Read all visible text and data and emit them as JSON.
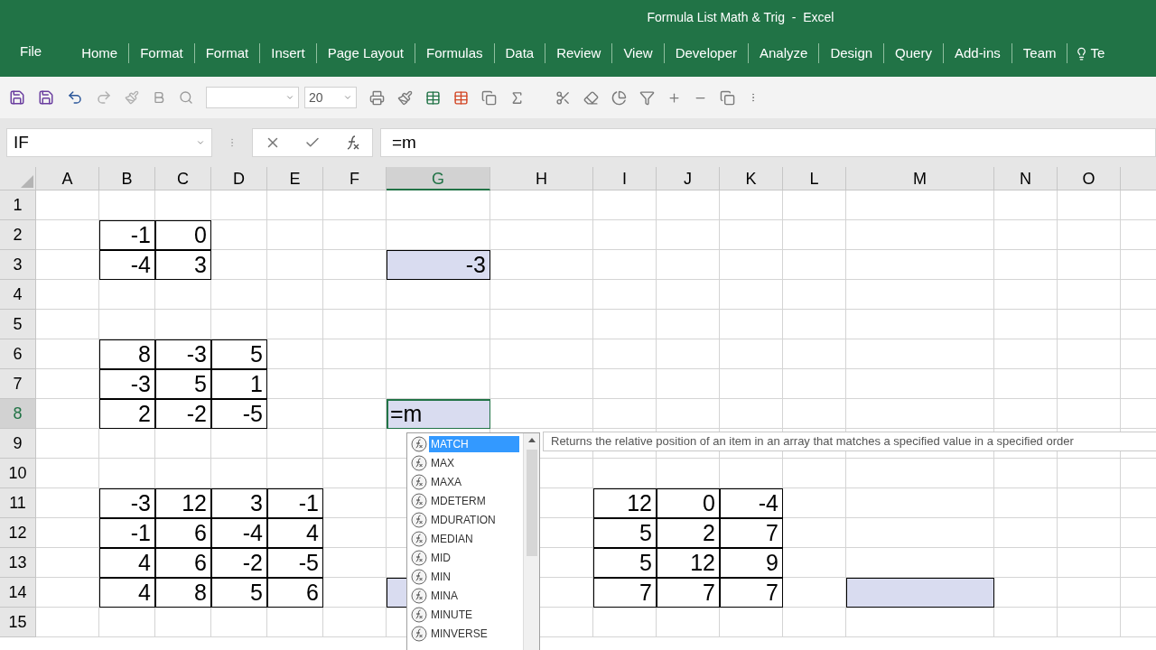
{
  "window": {
    "title": "Formula List Math & Trig  -  Excel"
  },
  "ribbon_tabs": [
    {
      "label": "File",
      "selected": false
    },
    {
      "label": "Home",
      "selected": false
    },
    {
      "label": "Format",
      "selected": false
    },
    {
      "label": "Format",
      "selected": false
    },
    {
      "label": "Insert",
      "selected": false
    },
    {
      "label": "Page Layout",
      "selected": false
    },
    {
      "label": "Formulas",
      "selected": false
    },
    {
      "label": "Data",
      "selected": false
    },
    {
      "label": "Review",
      "selected": false
    },
    {
      "label": "View",
      "selected": false
    },
    {
      "label": "Developer",
      "selected": false
    },
    {
      "label": "Analyze",
      "selected": false
    },
    {
      "label": "Design",
      "selected": false
    },
    {
      "label": "Query",
      "selected": false
    },
    {
      "label": "Add-ins",
      "selected": false
    },
    {
      "label": "Team",
      "selected": false
    }
  ],
  "tell_me": "Te",
  "toolbar": {
    "font_size": "20"
  },
  "formula_bar": {
    "name_box": "IF",
    "formula": "=m"
  },
  "columns": [
    {
      "letter": "A",
      "selected": false
    },
    {
      "letter": "B",
      "selected": false
    },
    {
      "letter": "C",
      "selected": false
    },
    {
      "letter": "D",
      "selected": false
    },
    {
      "letter": "E",
      "selected": false
    },
    {
      "letter": "F",
      "selected": false
    },
    {
      "letter": "G",
      "selected": true
    },
    {
      "letter": "H",
      "selected": false
    },
    {
      "letter": "I",
      "selected": false
    },
    {
      "letter": "J",
      "selected": false
    },
    {
      "letter": "K",
      "selected": false
    },
    {
      "letter": "L",
      "selected": false
    },
    {
      "letter": "M",
      "selected": false
    },
    {
      "letter": "N",
      "selected": false
    },
    {
      "letter": "O",
      "selected": false
    }
  ],
  "rows": [
    {
      "number": "1",
      "selected": false,
      "cells": [
        {
          "kind": "plain"
        },
        {
          "kind": "plain"
        },
        {
          "kind": "plain"
        },
        {
          "kind": "plain"
        },
        {
          "kind": "plain"
        },
        {
          "kind": "plain"
        },
        {
          "kind": "plain"
        },
        {
          "kind": "plain"
        },
        {
          "kind": "plain"
        },
        {
          "kind": "plain"
        },
        {
          "kind": "plain"
        },
        {
          "kind": "plain"
        },
        {
          "kind": "plain"
        },
        {
          "kind": "plain"
        },
        {
          "kind": "plain"
        }
      ]
    },
    {
      "number": "2",
      "selected": false,
      "cells": [
        {
          "kind": "plain"
        },
        {
          "kind": "boxed",
          "value": "-1"
        },
        {
          "kind": "boxed",
          "value": "0"
        },
        {
          "kind": "plain"
        },
        {
          "kind": "plain"
        },
        {
          "kind": "plain"
        },
        {
          "kind": "plain"
        },
        {
          "kind": "plain"
        },
        {
          "kind": "plain"
        },
        {
          "kind": "plain"
        },
        {
          "kind": "plain"
        },
        {
          "kind": "plain"
        },
        {
          "kind": "plain"
        },
        {
          "kind": "plain"
        },
        {
          "kind": "plain"
        }
      ]
    },
    {
      "number": "3",
      "selected": false,
      "cells": [
        {
          "kind": "plain"
        },
        {
          "kind": "boxed",
          "value": "-4"
        },
        {
          "kind": "boxed",
          "value": "3"
        },
        {
          "kind": "plain"
        },
        {
          "kind": "plain"
        },
        {
          "kind": "plain"
        },
        {
          "kind": "boxed-shaded",
          "value": "-3"
        },
        {
          "kind": "plain"
        },
        {
          "kind": "plain"
        },
        {
          "kind": "plain"
        },
        {
          "kind": "plain"
        },
        {
          "kind": "plain"
        },
        {
          "kind": "plain"
        },
        {
          "kind": "plain"
        },
        {
          "kind": "plain"
        }
      ]
    },
    {
      "number": "4",
      "selected": false,
      "cells": [
        {
          "kind": "plain"
        },
        {
          "kind": "plain"
        },
        {
          "kind": "plain"
        },
        {
          "kind": "plain"
        },
        {
          "kind": "plain"
        },
        {
          "kind": "plain"
        },
        {
          "kind": "plain"
        },
        {
          "kind": "plain"
        },
        {
          "kind": "plain"
        },
        {
          "kind": "plain"
        },
        {
          "kind": "plain"
        },
        {
          "kind": "plain"
        },
        {
          "kind": "plain"
        },
        {
          "kind": "plain"
        },
        {
          "kind": "plain"
        }
      ]
    },
    {
      "number": "5",
      "selected": false,
      "cells": [
        {
          "kind": "plain"
        },
        {
          "kind": "plain"
        },
        {
          "kind": "plain"
        },
        {
          "kind": "plain"
        },
        {
          "kind": "plain"
        },
        {
          "kind": "plain"
        },
        {
          "kind": "plain"
        },
        {
          "kind": "plain"
        },
        {
          "kind": "plain"
        },
        {
          "kind": "plain"
        },
        {
          "kind": "plain"
        },
        {
          "kind": "plain"
        },
        {
          "kind": "plain"
        },
        {
          "kind": "plain"
        },
        {
          "kind": "plain"
        }
      ]
    },
    {
      "number": "6",
      "selected": false,
      "cells": [
        {
          "kind": "plain"
        },
        {
          "kind": "boxed",
          "value": "8"
        },
        {
          "kind": "boxed",
          "value": "-3"
        },
        {
          "kind": "boxed",
          "value": "5"
        },
        {
          "kind": "plain"
        },
        {
          "kind": "plain"
        },
        {
          "kind": "plain"
        },
        {
          "kind": "plain"
        },
        {
          "kind": "plain"
        },
        {
          "kind": "plain"
        },
        {
          "kind": "plain"
        },
        {
          "kind": "plain"
        },
        {
          "kind": "plain"
        },
        {
          "kind": "plain"
        },
        {
          "kind": "plain"
        }
      ]
    },
    {
      "number": "7",
      "selected": false,
      "cells": [
        {
          "kind": "plain"
        },
        {
          "kind": "boxed",
          "value": "-3"
        },
        {
          "kind": "boxed",
          "value": "5"
        },
        {
          "kind": "boxed",
          "value": "1"
        },
        {
          "kind": "plain"
        },
        {
          "kind": "plain"
        },
        {
          "kind": "plain"
        },
        {
          "kind": "plain"
        },
        {
          "kind": "plain"
        },
        {
          "kind": "plain"
        },
        {
          "kind": "plain"
        },
        {
          "kind": "plain"
        },
        {
          "kind": "plain"
        },
        {
          "kind": "plain"
        },
        {
          "kind": "plain"
        }
      ]
    },
    {
      "number": "8",
      "selected": true,
      "cells": [
        {
          "kind": "plain"
        },
        {
          "kind": "boxed",
          "value": "2"
        },
        {
          "kind": "boxed",
          "value": "-2"
        },
        {
          "kind": "boxed",
          "value": "-5"
        },
        {
          "kind": "plain"
        },
        {
          "kind": "plain"
        },
        {
          "kind": "editing",
          "value": "=m"
        },
        {
          "kind": "plain"
        },
        {
          "kind": "plain"
        },
        {
          "kind": "plain"
        },
        {
          "kind": "plain"
        },
        {
          "kind": "plain"
        },
        {
          "kind": "plain"
        },
        {
          "kind": "plain"
        },
        {
          "kind": "plain"
        }
      ]
    },
    {
      "number": "9",
      "selected": false,
      "cells": [
        {
          "kind": "plain"
        },
        {
          "kind": "plain"
        },
        {
          "kind": "plain"
        },
        {
          "kind": "plain"
        },
        {
          "kind": "plain"
        },
        {
          "kind": "plain"
        },
        {
          "kind": "plain"
        },
        {
          "kind": "plain"
        },
        {
          "kind": "plain"
        },
        {
          "kind": "plain"
        },
        {
          "kind": "plain"
        },
        {
          "kind": "plain"
        },
        {
          "kind": "plain"
        },
        {
          "kind": "plain"
        },
        {
          "kind": "plain"
        }
      ]
    },
    {
      "number": "10",
      "selected": false,
      "cells": [
        {
          "kind": "plain"
        },
        {
          "kind": "plain"
        },
        {
          "kind": "plain"
        },
        {
          "kind": "plain"
        },
        {
          "kind": "plain"
        },
        {
          "kind": "plain"
        },
        {
          "kind": "plain"
        },
        {
          "kind": "plain"
        },
        {
          "kind": "plain"
        },
        {
          "kind": "plain"
        },
        {
          "kind": "plain"
        },
        {
          "kind": "plain"
        },
        {
          "kind": "plain"
        },
        {
          "kind": "plain"
        },
        {
          "kind": "plain"
        }
      ]
    },
    {
      "number": "11",
      "selected": false,
      "cells": [
        {
          "kind": "plain"
        },
        {
          "kind": "boxed",
          "value": "-3"
        },
        {
          "kind": "boxed",
          "value": "12"
        },
        {
          "kind": "boxed",
          "value": "3"
        },
        {
          "kind": "boxed",
          "value": "-1"
        },
        {
          "kind": "plain"
        },
        {
          "kind": "plain"
        },
        {
          "kind": "plain"
        },
        {
          "kind": "boxed",
          "value": "12"
        },
        {
          "kind": "boxed",
          "value": "0"
        },
        {
          "kind": "boxed",
          "value": "-4"
        },
        {
          "kind": "plain"
        },
        {
          "kind": "plain"
        },
        {
          "kind": "plain"
        },
        {
          "kind": "plain"
        }
      ]
    },
    {
      "number": "12",
      "selected": false,
      "cells": [
        {
          "kind": "plain"
        },
        {
          "kind": "boxed",
          "value": "-1"
        },
        {
          "kind": "boxed",
          "value": "6"
        },
        {
          "kind": "boxed",
          "value": "-4"
        },
        {
          "kind": "boxed",
          "value": "4"
        },
        {
          "kind": "plain"
        },
        {
          "kind": "plain"
        },
        {
          "kind": "plain"
        },
        {
          "kind": "boxed",
          "value": "5"
        },
        {
          "kind": "boxed",
          "value": "2"
        },
        {
          "kind": "boxed",
          "value": "7"
        },
        {
          "kind": "plain"
        },
        {
          "kind": "plain"
        },
        {
          "kind": "plain"
        },
        {
          "kind": "plain"
        }
      ]
    },
    {
      "number": "13",
      "selected": false,
      "cells": [
        {
          "kind": "plain"
        },
        {
          "kind": "boxed",
          "value": "4"
        },
        {
          "kind": "boxed",
          "value": "6"
        },
        {
          "kind": "boxed",
          "value": "-2"
        },
        {
          "kind": "boxed",
          "value": "-5"
        },
        {
          "kind": "plain"
        },
        {
          "kind": "plain"
        },
        {
          "kind": "plain"
        },
        {
          "kind": "boxed",
          "value": "5"
        },
        {
          "kind": "boxed",
          "value": "12"
        },
        {
          "kind": "boxed",
          "value": "9"
        },
        {
          "kind": "plain"
        },
        {
          "kind": "plain"
        },
        {
          "kind": "plain"
        },
        {
          "kind": "plain"
        }
      ]
    },
    {
      "number": "14",
      "selected": false,
      "cells": [
        {
          "kind": "plain"
        },
        {
          "kind": "boxed",
          "value": "4"
        },
        {
          "kind": "boxed",
          "value": "8"
        },
        {
          "kind": "boxed",
          "value": "5"
        },
        {
          "kind": "boxed",
          "value": "6"
        },
        {
          "kind": "plain"
        },
        {
          "kind": "boxed-shaded"
        },
        {
          "kind": "plain"
        },
        {
          "kind": "boxed",
          "value": "7"
        },
        {
          "kind": "boxed",
          "value": "7"
        },
        {
          "kind": "boxed",
          "value": "7"
        },
        {
          "kind": "plain"
        },
        {
          "kind": "boxed-shaded"
        },
        {
          "kind": "plain"
        },
        {
          "kind": "plain"
        }
      ]
    },
    {
      "number": "15",
      "selected": false,
      "cells": [
        {
          "kind": "plain"
        },
        {
          "kind": "plain"
        },
        {
          "kind": "plain"
        },
        {
          "kind": "plain"
        },
        {
          "kind": "plain"
        },
        {
          "kind": "plain"
        },
        {
          "kind": "plain"
        },
        {
          "kind": "plain"
        },
        {
          "kind": "plain"
        },
        {
          "kind": "plain"
        },
        {
          "kind": "plain"
        },
        {
          "kind": "plain"
        },
        {
          "kind": "plain"
        },
        {
          "kind": "plain"
        },
        {
          "kind": "plain"
        }
      ]
    }
  ],
  "autocomplete": {
    "items": [
      {
        "label": "MATCH",
        "selected": true
      },
      {
        "label": "MAX",
        "selected": false
      },
      {
        "label": "MAXA",
        "selected": false
      },
      {
        "label": "MDETERM",
        "selected": false
      },
      {
        "label": "MDURATION",
        "selected": false
      },
      {
        "label": "MEDIAN",
        "selected": false
      },
      {
        "label": "MID",
        "selected": false
      },
      {
        "label": "MIN",
        "selected": false
      },
      {
        "label": "MINA",
        "selected": false
      },
      {
        "label": "MINUTE",
        "selected": false
      },
      {
        "label": "MINVERSE",
        "selected": false
      }
    ],
    "tooltip": "Returns the relative position of an item in an array that matches a specified value in a specified order"
  }
}
